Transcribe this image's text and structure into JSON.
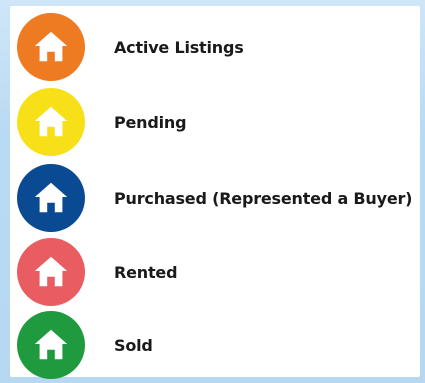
{
  "legend": {
    "items": [
      {
        "label": "Active Listings",
        "color": "#ee7a22",
        "icon": "house-icon"
      },
      {
        "label": "Pending",
        "color": "#f7e018",
        "icon": "house-icon"
      },
      {
        "label": "Purchased (Represented a Buyer)",
        "color": "#0a4a93",
        "icon": "house-icon"
      },
      {
        "label": "Rented",
        "color": "#e95c62",
        "icon": "house-icon"
      },
      {
        "label": "Sold",
        "color": "#1f9a3e",
        "icon": "house-icon"
      }
    ]
  }
}
